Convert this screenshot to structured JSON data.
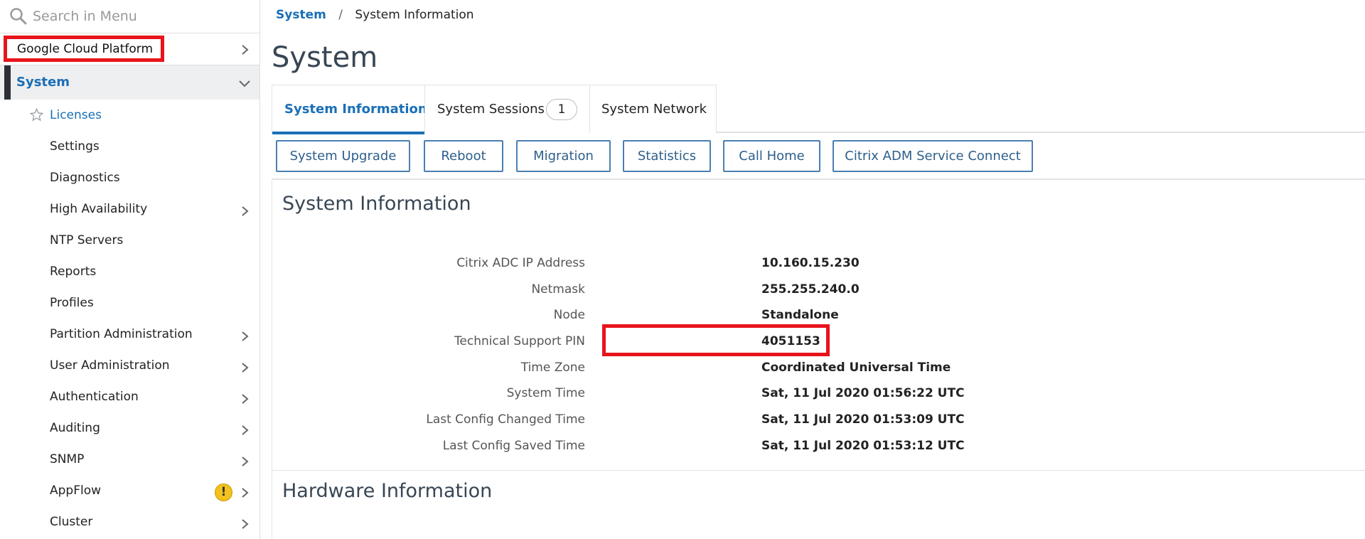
{
  "sidebar": {
    "search_placeholder": "Search in Menu",
    "search_icon": "search-icon",
    "top_item": {
      "label": "Google Cloud Platform",
      "highlight_color": "#e8141b"
    },
    "section": {
      "label": "System",
      "expanded": true
    },
    "items": [
      {
        "label": "Licenses",
        "active": true,
        "favorite_icon": "star-icon"
      },
      {
        "label": "Settings"
      },
      {
        "label": "Diagnostics"
      },
      {
        "label": "High Availability",
        "has_children": true
      },
      {
        "label": "NTP Servers"
      },
      {
        "label": "Reports"
      },
      {
        "label": "Profiles"
      },
      {
        "label": "Partition Administration",
        "has_children": true
      },
      {
        "label": "User Administration",
        "has_children": true
      },
      {
        "label": "Authentication",
        "has_children": true
      },
      {
        "label": "Auditing",
        "has_children": true
      },
      {
        "label": "SNMP",
        "has_children": true
      },
      {
        "label": "AppFlow",
        "has_children": true,
        "warning": "!"
      },
      {
        "label": "Cluster",
        "has_children": true
      }
    ]
  },
  "breadcrumb": {
    "parent": "System",
    "separator": "/",
    "current": "System Information"
  },
  "page_title": "System",
  "tabs": [
    {
      "label": "System Information",
      "active": true
    },
    {
      "label": "System Sessions",
      "badge": "1"
    },
    {
      "label": "System Network"
    }
  ],
  "toolbar": {
    "buttons": [
      "System Upgrade",
      "Reboot",
      "Migration",
      "Statistics",
      "Call Home",
      "Citrix ADM Service Connect"
    ]
  },
  "system_information": {
    "title": "System Information",
    "rows": [
      {
        "label": "Citrix ADC IP Address",
        "value": "10.160.15.230"
      },
      {
        "label": "Netmask",
        "value": "255.255.240.0"
      },
      {
        "label": "Node",
        "value": "Standalone"
      },
      {
        "label": "Technical Support PIN",
        "value": "4051153",
        "highlighted": true
      },
      {
        "label": "Time Zone",
        "value": "Coordinated Universal Time"
      },
      {
        "label": "System Time",
        "value": "Sat, 11 Jul 2020 01:56:22 UTC"
      },
      {
        "label": "Last Config Changed Time",
        "value": "Sat, 11 Jul 2020 01:53:09 UTC"
      },
      {
        "label": "Last Config Saved Time",
        "value": "Sat, 11 Jul 2020 01:53:12 UTC"
      }
    ]
  },
  "hardware_information": {
    "title": "Hardware Information"
  },
  "colors": {
    "accent": "#1a6fb7",
    "highlight": "#e8141b",
    "warning": "#f3c21e",
    "title": "#384654",
    "button_border": "#4a7fb0"
  }
}
